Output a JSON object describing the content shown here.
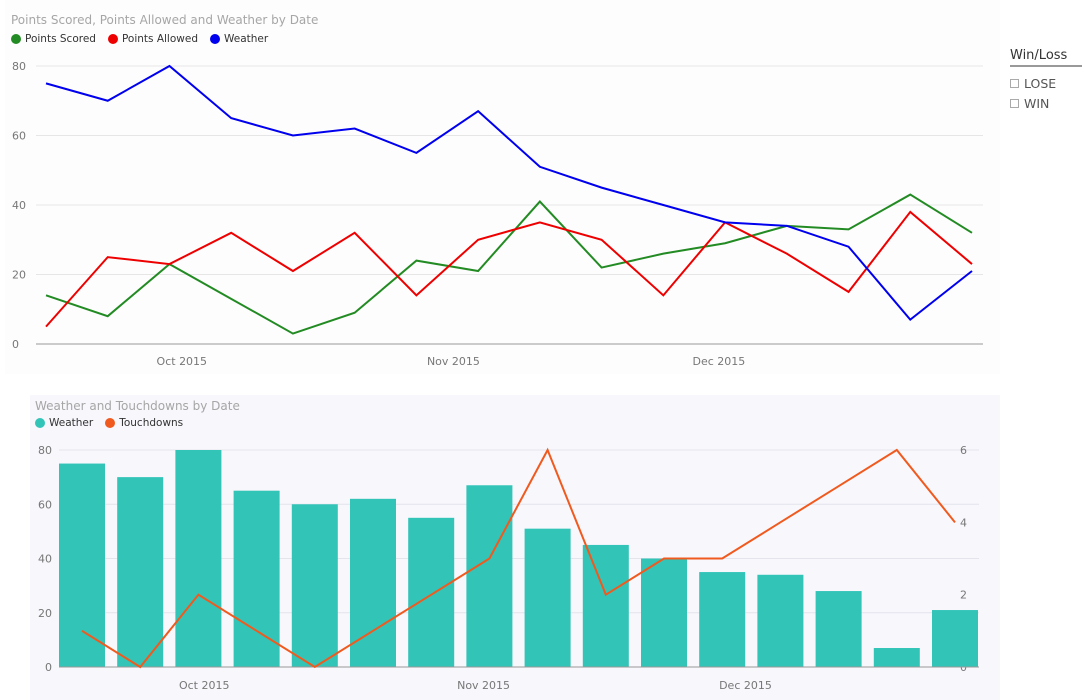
{
  "chart_data": [
    {
      "type": "line",
      "title": "Points Scored, Points Allowed and Weather by Date",
      "xlabel": "",
      "ylabel": "",
      "ylim": [
        0,
        80
      ],
      "yticks": [
        0,
        20,
        40,
        60,
        80
      ],
      "xtick_labels": [
        "Oct 2015",
        "Nov 2015",
        "Dec 2015"
      ],
      "xtick_positions": [
        2.2,
        6.6,
        10.9
      ],
      "grid": true,
      "legend": "top-left",
      "x": [
        0,
        1,
        2,
        3,
        4,
        5,
        6,
        7,
        8,
        9,
        10,
        11,
        12,
        13,
        14,
        15
      ],
      "series": [
        {
          "name": "Points Scored",
          "color": "#238b23",
          "values": [
            14,
            8,
            23,
            13,
            3,
            9,
            24,
            21,
            41,
            22,
            26,
            29,
            34,
            33,
            43,
            32
          ]
        },
        {
          "name": "Points Allowed",
          "color": "#ee0000",
          "values": [
            5,
            25,
            23,
            32,
            21,
            32,
            14,
            30,
            35,
            30,
            14,
            35,
            26,
            15,
            38,
            23
          ]
        },
        {
          "name": "Weather",
          "color": "#0000ee",
          "values": [
            75,
            70,
            80,
            65,
            60,
            62,
            55,
            67,
            51,
            45,
            40,
            35,
            34,
            28,
            7,
            21
          ]
        }
      ]
    },
    {
      "type": "bar",
      "title": "Weather and Touchdowns by Date",
      "xlabel": "",
      "ylabel": "",
      "ylim": [
        0,
        80
      ],
      "yticks": [
        0,
        20,
        40,
        60,
        80
      ],
      "y2lim": [
        0,
        6
      ],
      "y2ticks": [
        0,
        2,
        4,
        6
      ],
      "xtick_labels": [
        "Oct 2015",
        "Nov 2015",
        "Dec 2015"
      ],
      "xtick_positions": [
        2.1,
        6.9,
        11.4
      ],
      "grid": true,
      "legend": "top-left",
      "x": [
        0,
        1,
        2,
        3,
        4,
        5,
        6,
        7,
        8,
        9,
        10,
        11,
        12,
        13,
        14,
        15
      ],
      "series": [
        {
          "name": "Weather",
          "type": "bar",
          "axis": "left",
          "color": "#33c4b8",
          "values": [
            75,
            70,
            80,
            65,
            60,
            62,
            55,
            67,
            51,
            45,
            40,
            35,
            34,
            28,
            7,
            21
          ]
        },
        {
          "name": "Touchdowns",
          "type": "line",
          "axis": "right",
          "color": "#f05a1e",
          "values": [
            1,
            0,
            2,
            1,
            0,
            1,
            2,
            3,
            6,
            2,
            3,
            3,
            4,
            5,
            6,
            4
          ]
        }
      ]
    }
  ],
  "slicer": {
    "title": "Win/Loss",
    "items": [
      {
        "label": "LOSE"
      },
      {
        "label": "WIN"
      }
    ]
  }
}
